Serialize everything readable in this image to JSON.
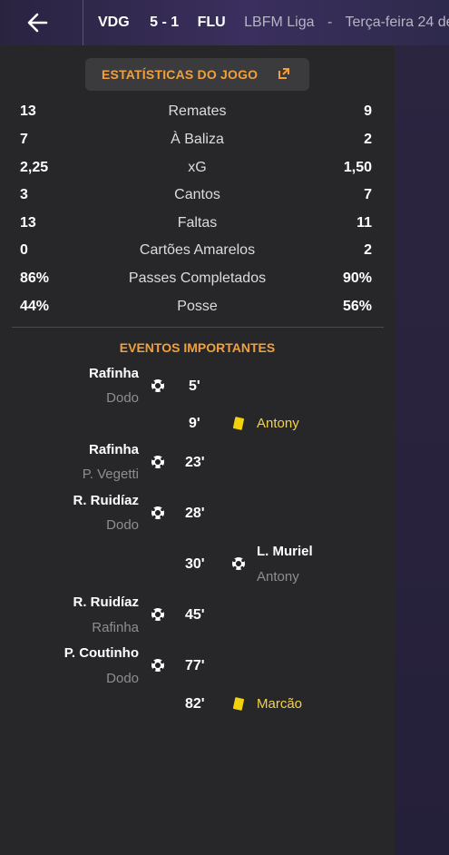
{
  "header": {
    "home_team": "VDG",
    "score": "5 - 1",
    "away_team": "FLU",
    "competition": "LBFM Liga",
    "separator": "-",
    "date": "Terça-feira 24 de"
  },
  "stats": {
    "title": "ESTATÍSTICAS DO JOGO",
    "rows": [
      {
        "home": "13",
        "label": "Remates",
        "away": "9"
      },
      {
        "home": "7",
        "label": "À Baliza",
        "away": "2"
      },
      {
        "home": "2,25",
        "label": "xG",
        "away": "1,50"
      },
      {
        "home": "3",
        "label": "Cantos",
        "away": "7"
      },
      {
        "home": "13",
        "label": "Faltas",
        "away": "11"
      },
      {
        "home": "0",
        "label": "Cartões Amarelos",
        "away": "2"
      },
      {
        "home": "86%",
        "label": "Passes Completados",
        "away": "90%"
      },
      {
        "home": "44%",
        "label": "Posse",
        "away": "56%"
      }
    ]
  },
  "events": {
    "title": "EVENTOS IMPORTANTES",
    "items": [
      {
        "minute": "5'",
        "player": "Rafinha",
        "assist": "Dodo",
        "type": "goal",
        "side": "home"
      },
      {
        "minute": "9'",
        "player": "Antony",
        "type": "yellow-card",
        "side": "away"
      },
      {
        "minute": "23'",
        "player": "Rafinha",
        "assist": "P. Vegetti",
        "type": "goal",
        "side": "home"
      },
      {
        "minute": "28'",
        "player": "R. Ruidíaz",
        "assist": "Dodo",
        "type": "goal",
        "side": "home"
      },
      {
        "minute": "30'",
        "player": "L. Muriel",
        "assist": "Antony",
        "type": "goal",
        "side": "away"
      },
      {
        "minute": "45'",
        "player": "R. Ruidíaz",
        "assist": "Rafinha",
        "type": "goal",
        "side": "home"
      },
      {
        "minute": "77'",
        "player": "P. Coutinho",
        "assist": "Dodo",
        "type": "goal",
        "side": "home"
      },
      {
        "minute": "82'",
        "player": "Marcão",
        "type": "yellow-card",
        "side": "away"
      }
    ]
  },
  "colors": {
    "accent": "#f2a03b",
    "card_yellow": "#f2d20a",
    "card_player": "#f4d24a"
  }
}
